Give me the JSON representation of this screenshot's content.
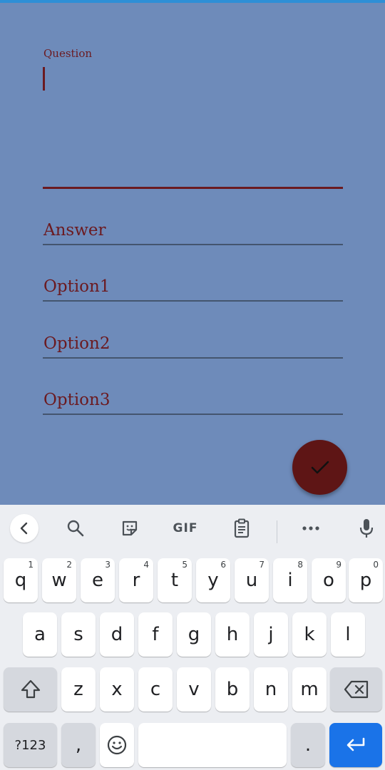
{
  "form": {
    "question_label": "Question",
    "answer_placeholder": "Answer",
    "option1_placeholder": "Option1",
    "option2_placeholder": "Option2",
    "option3_placeholder": "Option3"
  },
  "fab": {
    "icon": "check-icon"
  },
  "keyboard": {
    "toolbar": {
      "back_icon": "chevron-left-icon",
      "search_icon": "search-icon",
      "sticker_icon": "sticker-icon",
      "gif_label": "GIF",
      "clipboard_icon": "clipboard-icon",
      "more_icon": "more-icon",
      "mic_icon": "mic-icon"
    },
    "row1": [
      {
        "key": "q",
        "hint": "1"
      },
      {
        "key": "w",
        "hint": "2"
      },
      {
        "key": "e",
        "hint": "3"
      },
      {
        "key": "r",
        "hint": "4"
      },
      {
        "key": "t",
        "hint": "5"
      },
      {
        "key": "y",
        "hint": "6"
      },
      {
        "key": "u",
        "hint": "7"
      },
      {
        "key": "i",
        "hint": "8"
      },
      {
        "key": "o",
        "hint": "9"
      },
      {
        "key": "p",
        "hint": "0"
      }
    ],
    "row2": [
      "a",
      "s",
      "d",
      "f",
      "g",
      "h",
      "j",
      "k",
      "l"
    ],
    "row3": [
      "z",
      "x",
      "c",
      "v",
      "b",
      "n",
      "m"
    ],
    "symbols_label": "?123",
    "comma_label": ",",
    "period_label": ".",
    "shift_icon": "shift-icon",
    "backspace_icon": "backspace-icon",
    "emoji_icon": "emoji-icon",
    "enter_icon": "enter-icon"
  },
  "colors": {
    "form_background": "#6e8bba",
    "accent": "#6b1a20",
    "fab": "#5e1515",
    "enter_key": "#1a73e8"
  }
}
